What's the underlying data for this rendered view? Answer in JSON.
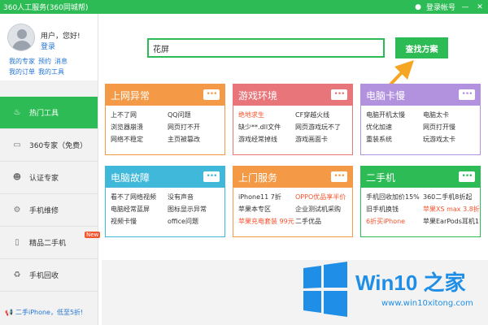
{
  "window": {
    "title": "360人工服务(360同城帮)",
    "account": "登录帐号",
    "minimize": "—",
    "close": "✕"
  },
  "profile": {
    "greeting": "用户，您好!",
    "login": "登录",
    "links1": [
      "我的专家",
      "预约",
      "消息"
    ],
    "links2": [
      "我的订单",
      "我的工具"
    ]
  },
  "sidebar": {
    "items": [
      {
        "label": "热门工具",
        "icon": "flame-icon"
      },
      {
        "label": "360专家（免费）",
        "icon": "monitor-icon"
      },
      {
        "label": "认证专家",
        "icon": "user-icon"
      },
      {
        "label": "手机维修",
        "icon": "gear-icon"
      },
      {
        "label": "精品二手机",
        "icon": "phone-icon",
        "badge": "New"
      },
      {
        "label": "手机回收",
        "icon": "recycle-icon"
      }
    ],
    "promo": "二手iPhone，低至5折!"
  },
  "search": {
    "value": "花屏",
    "button": "查找方案"
  },
  "cards": [
    {
      "title": "上网异常",
      "color": "#f49a46",
      "items": [
        "上不了网",
        "QQ问题",
        "浏览器崩溃",
        "网页打不开",
        "网络不稳定",
        "主页被篡改"
      ],
      "hl": []
    },
    {
      "title": "游戏环境",
      "color": "#e8757a",
      "items": [
        "绝地求生",
        "CF穿越火线",
        "缺少**.dll文件",
        "网页游戏玩不了",
        "游戏经常掉线",
        "游戏画面卡"
      ],
      "hl": [
        0
      ]
    },
    {
      "title": "电脑卡慢",
      "color": "#b292de",
      "items": [
        "电脑开机太慢",
        "电脑太卡",
        "优化加速",
        "网页打开慢",
        "重装系统",
        "玩游戏太卡"
      ],
      "hl": []
    },
    {
      "title": "电脑故障",
      "color": "#3fb8da",
      "items": [
        "看不了网络视频",
        "没有声音",
        "电脑经常蓝屏",
        "图标显示异常",
        "视频卡慢",
        "office问题"
      ],
      "hl": []
    },
    {
      "title": "上门服务",
      "color": "#f49a46",
      "items": [
        "iPhone11 7折",
        "OPPO优品享半价",
        "苹果本专区",
        "企业测试机采购",
        "苹果充电套装 99元",
        "二手优品"
      ],
      "hl": [
        1,
        4
      ]
    },
    {
      "title": "二手机",
      "color": "#2dbb55",
      "items": [
        "手机回收加价15%",
        "360二手机8折起",
        "旧手机换钱",
        "苹果XS max 3.8折",
        "6折买iPhone",
        "苹果EarPods耳机11"
      ],
      "hl": [
        3,
        4
      ]
    }
  ],
  "watermark": {
    "brand": "Win10 之家",
    "url": "www.win10xitong.com"
  }
}
